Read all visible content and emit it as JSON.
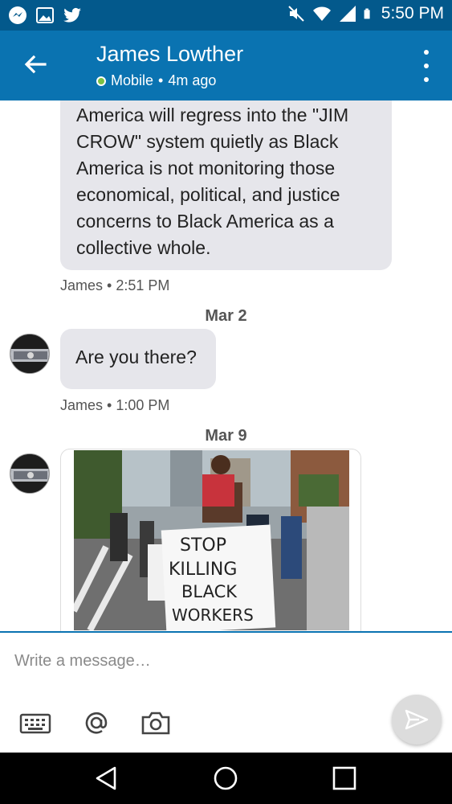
{
  "status_bar": {
    "time": "5:50 PM",
    "left_icons": [
      "messenger-icon",
      "gallery-icon",
      "twitter-icon"
    ],
    "right_icons": [
      "mute-icon",
      "wifi-icon",
      "signal-icon",
      "battery-icon"
    ]
  },
  "header": {
    "contact_name": "James Lowther",
    "presence": "Mobile",
    "separator": "•",
    "last_seen": "4m ago",
    "colors": {
      "status_bar": "#03598c",
      "app_bar": "#0a73b1",
      "presence": "#7ac143"
    }
  },
  "conversation": {
    "messages": [
      {
        "text": "America will regress into the \"JIM CROW\" system quietly as Black America is not monitoring those economical,  political, and justice concerns to Black America as a collective whole.",
        "meta": "James • 2:51 PM"
      },
      {
        "date": "Mar 2",
        "text": "Are you there?",
        "meta": "James • 1:00 PM"
      },
      {
        "date": "Mar 9",
        "image_sign_text": [
          "STOP",
          "KILLING",
          "BLACK",
          "WORKERS"
        ]
      }
    ]
  },
  "composer": {
    "placeholder": "Write a message…",
    "tools": [
      "keyboard-icon",
      "mention-icon",
      "camera-icon"
    ],
    "send_icon": "send-icon"
  },
  "nav_bar": {
    "buttons": [
      "back-icon",
      "home-icon",
      "recents-icon"
    ]
  }
}
